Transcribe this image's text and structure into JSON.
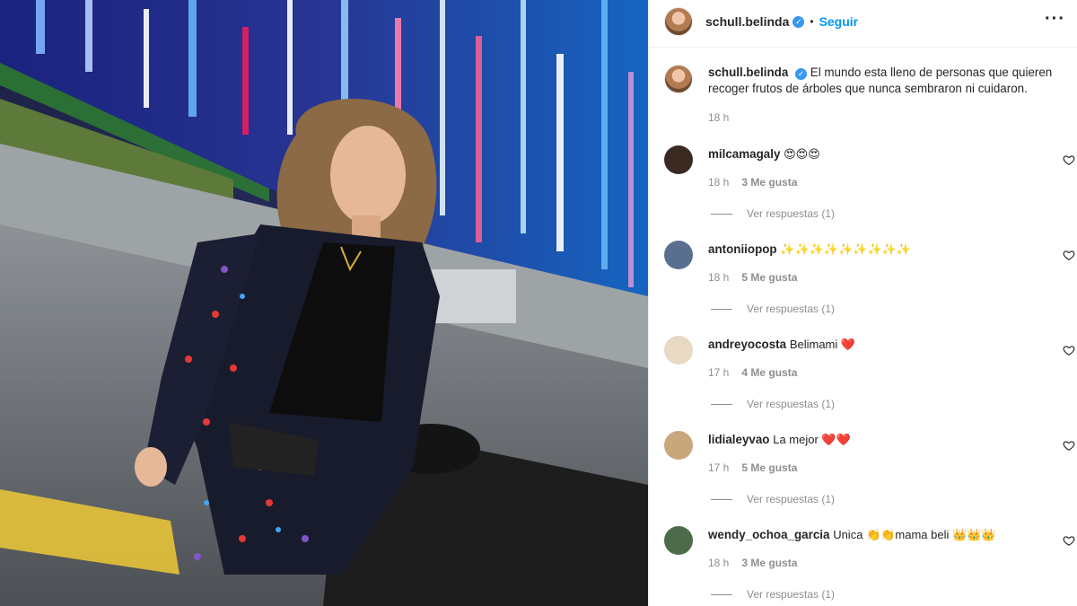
{
  "post": {
    "username": "schull.belinda",
    "follow_label": "Seguir",
    "separator": "•",
    "more_label": "···",
    "caption": "El mundo esta lleno de personas que quieren recoger frutos de árboles que nunca sembraron ni cuidaron.",
    "caption_time": "18 h"
  },
  "comments": [
    {
      "username": "milcamagaly",
      "text": "😍😍😍",
      "time": "18 h",
      "likes": "3 Me gusta",
      "replies": "Ver respuestas (1)",
      "avatar_color": "#3a2a22"
    },
    {
      "username": "antoniiopop",
      "text": "✨✨✨✨✨✨✨✨✨",
      "time": "18 h",
      "likes": "5 Me gusta",
      "replies": "Ver respuestas (1)",
      "avatar_color": "#5a6f8f"
    },
    {
      "username": "andreyocosta",
      "text": "Belimami ❤️",
      "time": "17 h",
      "likes": "4 Me gusta",
      "replies": "Ver respuestas (1)",
      "avatar_color": "#e8d9c4"
    },
    {
      "username": "lidialeyvao",
      "text": "La mejor ❤️❤️",
      "time": "17 h",
      "likes": "5 Me gusta",
      "replies": "Ver respuestas (1)",
      "avatar_color": "#c9a77c"
    },
    {
      "username": "wendy_ochoa_garcia",
      "text": "Unica 👏👏mama beli 👑👑👑",
      "time": "18 h",
      "likes": "3 Me gusta",
      "replies": "Ver respuestas (1)",
      "avatar_color": "#4d6b4a"
    }
  ],
  "colors": {
    "link_blue": "#0095f6",
    "verified_blue": "#3897f0",
    "muted_text": "#8e8e8e",
    "primary_text": "#262626"
  },
  "icons": [
    "verified-badge-icon",
    "more-options-icon",
    "heart-like-icon"
  ]
}
